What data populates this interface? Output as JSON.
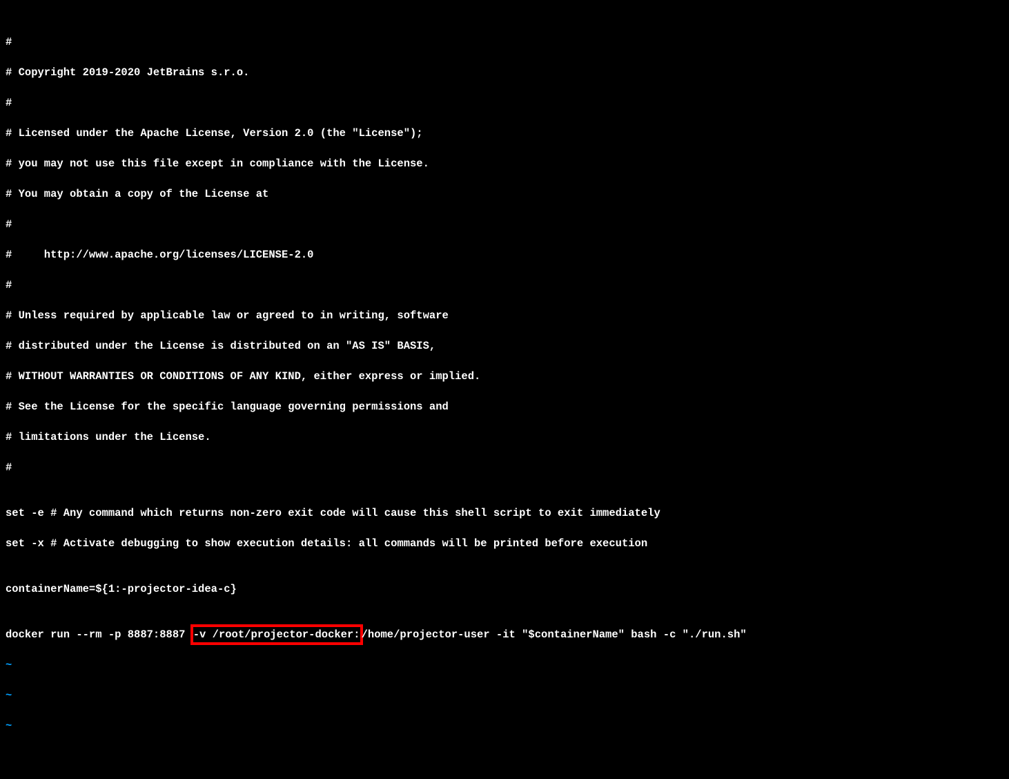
{
  "lines": {
    "l0": "#",
    "l1": "# Copyright 2019-2020 JetBrains s.r.o.",
    "l2": "#",
    "l3": "# Licensed under the Apache License, Version 2.0 (the \"License\");",
    "l4": "# you may not use this file except in compliance with the License.",
    "l5": "# You may obtain a copy of the License at",
    "l6": "#",
    "l7": "#     http://www.apache.org/licenses/LICENSE-2.0",
    "l8": "#",
    "l9": "# Unless required by applicable law or agreed to in writing, software",
    "l10": "# distributed under the License is distributed on an \"AS IS\" BASIS,",
    "l11": "# WITHOUT WARRANTIES OR CONDITIONS OF ANY KIND, either express or implied.",
    "l12": "# See the License for the specific language governing permissions and",
    "l13": "# limitations under the License.",
    "l14": "#",
    "l15": "",
    "l16": "set -e # Any command which returns non-zero exit code will cause this shell script to exit immediately",
    "l17": "set -x # Activate debugging to show execution details: all commands will be printed before execution",
    "l18": "",
    "l19": "containerName=${1:-projector-idea-c}",
    "l20": "",
    "docker_pre": "docker run --rm -p 8887:8887 ",
    "docker_highlight": "-v /root/projector-docker:",
    "docker_post": "/home/projector-user -it \"$containerName\" bash -c \"./run.sh\"",
    "tilde": "~"
  }
}
